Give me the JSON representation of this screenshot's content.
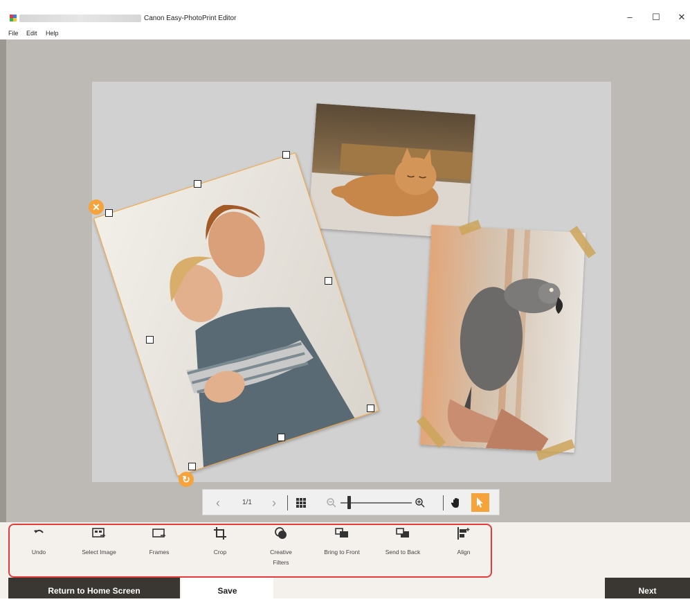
{
  "window": {
    "title": "Canon Easy-PhotoPrint Editor",
    "minimize_glyph": "–",
    "maximize_glyph": "☐",
    "close_glyph": "✕"
  },
  "menu": {
    "items": [
      "File",
      "Edit",
      "Help"
    ]
  },
  "canvas": {
    "photos": [
      {
        "name": "couple-photo",
        "subject": "couple-icon"
      },
      {
        "name": "cat-photo",
        "subject": "cat-icon"
      },
      {
        "name": "parrot-photo",
        "subject": "parrot-icon"
      }
    ],
    "selection": {
      "delete_glyph": "✕",
      "rotate_glyph": "↻"
    }
  },
  "nav": {
    "prev_glyph": "‹",
    "page": "1/1",
    "next_glyph": "›",
    "zoom_level": 0.1
  },
  "toolbar": {
    "tools": [
      {
        "label": "Undo",
        "icon": "undo-icon"
      },
      {
        "label": "Select Image",
        "icon": "select-image-icon"
      },
      {
        "label": "Frames",
        "icon": "frames-icon"
      },
      {
        "label": "Crop",
        "icon": "crop-icon"
      },
      {
        "label": "Creative\nFilters",
        "icon": "creative-filters-icon"
      },
      {
        "label": "Bring to Front",
        "icon": "bring-to-front-icon"
      },
      {
        "label": "Send to Back",
        "icon": "send-to-back-icon"
      },
      {
        "label": "Align",
        "icon": "align-icon"
      }
    ]
  },
  "footer": {
    "return_label": "Return to Home Screen",
    "save_label": "Save",
    "next_label": "Next"
  },
  "colors": {
    "accent": "#f5a33a",
    "highlight_outline": "#e53a3a",
    "footer_dark": "#3a3632"
  }
}
